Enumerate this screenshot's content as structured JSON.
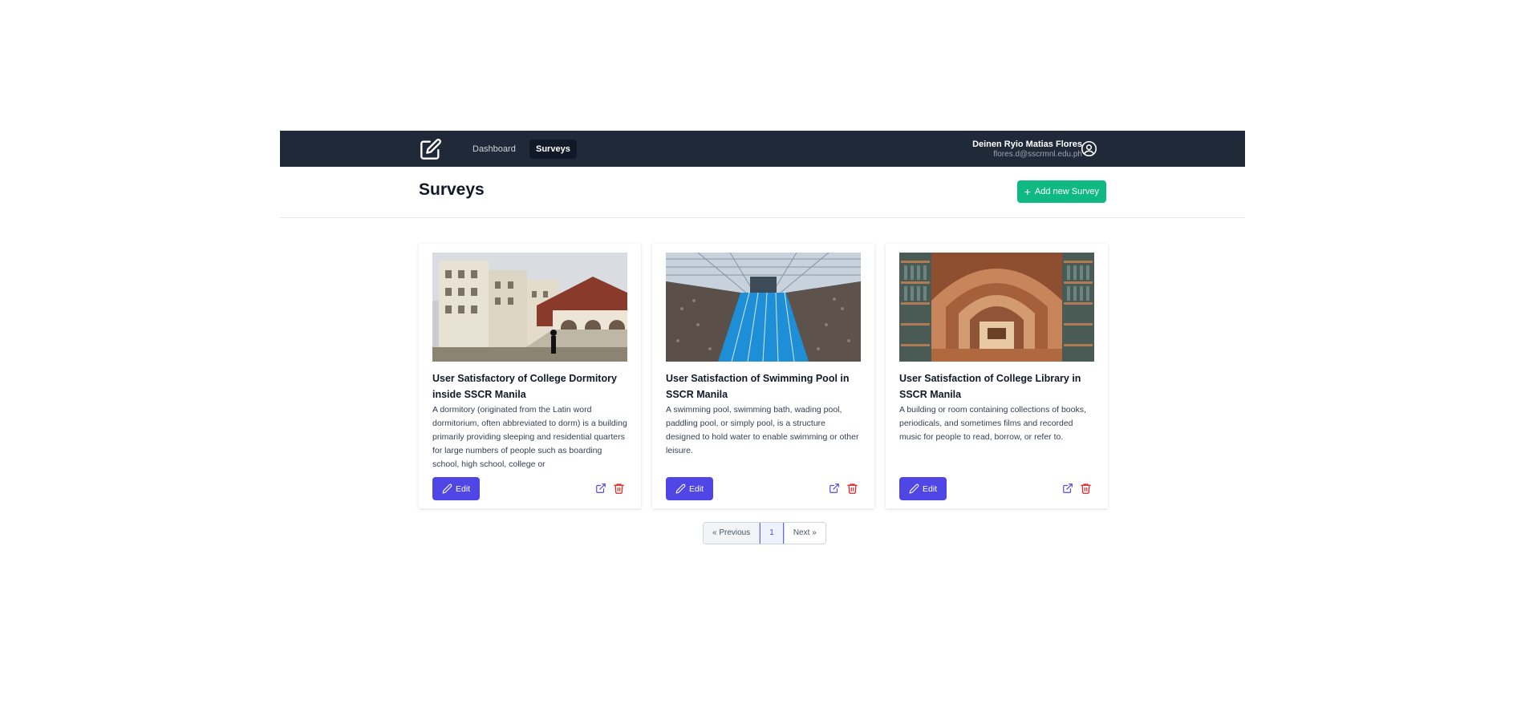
{
  "nav": {
    "links": [
      {
        "label": "Dashboard",
        "active": false
      },
      {
        "label": "Surveys",
        "active": true
      }
    ],
    "user_name": "Deinen Ryio Matias Flores",
    "user_email": "flores.d@sscrmnl.edu.ph"
  },
  "header": {
    "title": "Surveys",
    "add_label": "Add new Survey"
  },
  "cards": [
    {
      "image": "dormitory-building-photo",
      "title": "User Satisfactory of College Dormitory inside SSCR Manila",
      "description": "A dormitory (originated from the Latin word dormitorium, often abbreviated to dorm) is a building primarily providing sleeping and residential quarters for large numbers of people such as boarding school, high school, college or",
      "edit_label": "Edit"
    },
    {
      "image": "swimming-pool-photo",
      "title": "User Satisfaction of Swimming Pool in SSCR Manila",
      "description": "A swimming pool, swimming bath, wading pool, paddling pool, or simply pool, is a structure designed to hold water to enable swimming or other leisure.",
      "edit_label": "Edit"
    },
    {
      "image": "library-interior-photo",
      "title": "User Satisfaction of College Library in SSCR Manila",
      "description": "A building or room containing collections of books, periodicals, and sometimes films and recorded music for people to read, borrow, or refer to.",
      "edit_label": "Edit"
    }
  ],
  "pagination": {
    "prev_label": "« Previous",
    "current": "1",
    "next_label": "Next »"
  },
  "colors": {
    "navbar": "#1f2937",
    "add_button": "#10b981",
    "edit_button": "#4f46e5",
    "delete_icon": "#dc2626",
    "open_icon": "#4f46e5"
  }
}
